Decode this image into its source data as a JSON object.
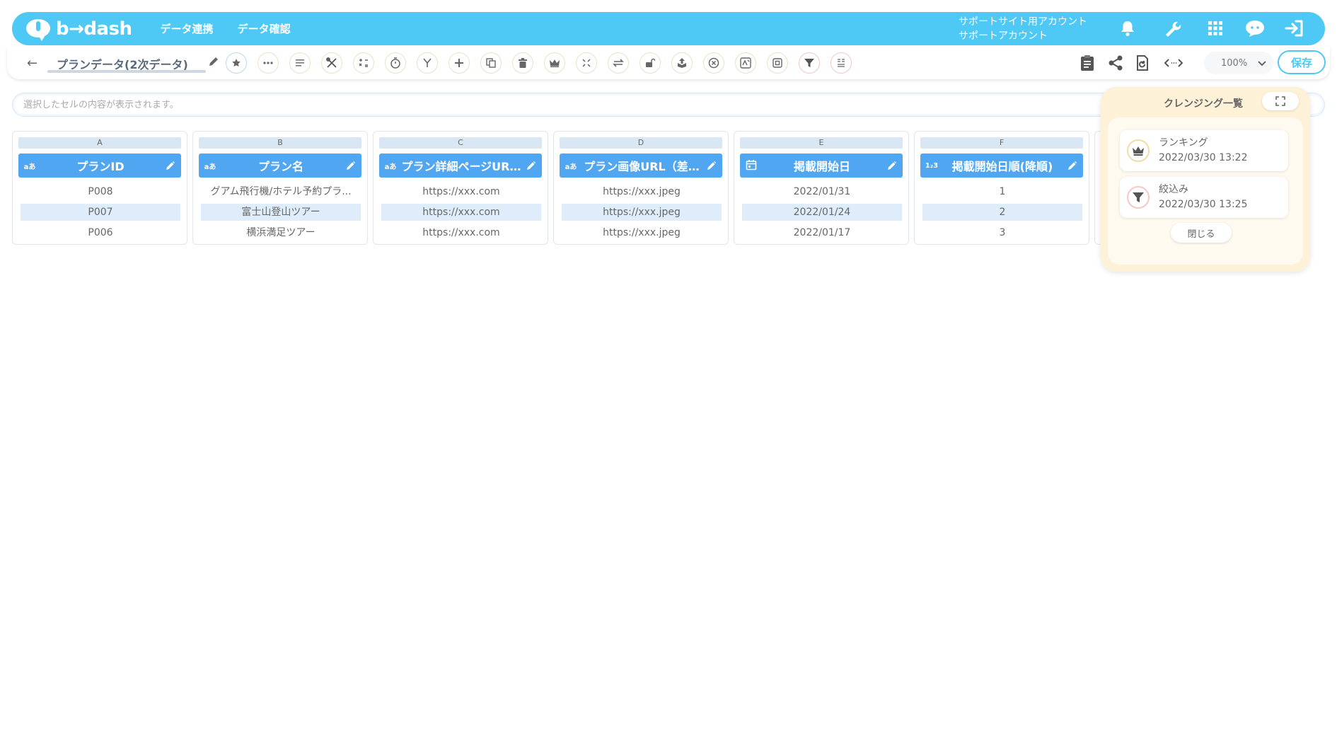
{
  "app": {
    "logo_text": "b→dash",
    "nav": [
      "データ連携",
      "データ確認"
    ],
    "account_line1": "サポートサイト用アカウント",
    "account_line2": "サポートアカウント"
  },
  "header_icons": [
    "bell-icon",
    "wrench-icon",
    "grid-icon",
    "chat-icon",
    "logout-icon"
  ],
  "toolbar": {
    "back_icon": "←",
    "dataset_title": "プランデータ(2次データ)",
    "tools": [
      "star-icon",
      "dots-icon",
      "list-icon",
      "tools-icon",
      "calculator-icon",
      "timer-icon",
      "merge-icon",
      "plus-icon",
      "copy-icon",
      "trash-icon",
      "crown-icon",
      "collapse-icon",
      "swap-icon",
      "lock-icon",
      "upload-icon",
      "cancel-icon",
      "transform-icon",
      "square-icon",
      "filter-icon",
      "sort-icon"
    ],
    "right_icons": [
      "clipboard-icon",
      "share-icon",
      "refresh-icon",
      "code-icon"
    ],
    "zoom": "100%",
    "save_label": "保存"
  },
  "cellbar": {
    "placeholder": "選択したセルの内容が表示されます。"
  },
  "columns": [
    {
      "letter": "A",
      "type": "aあ",
      "name": "プランID",
      "cells": [
        "P008",
        "P007",
        "P006"
      ]
    },
    {
      "letter": "B",
      "type": "aあ",
      "name": "プラン名",
      "cells": [
        "グアム飛行機/ホテル予約プラ...",
        "富士山登山ツアー",
        "横浜満足ツアー"
      ]
    },
    {
      "letter": "C",
      "type": "aあ",
      "name": "プラン詳細ページUR…",
      "cells": [
        "https://xxx.com",
        "https://xxx.com",
        "https://xxx.com"
      ]
    },
    {
      "letter": "D",
      "type": "aあ",
      "name": "プラン画像URL（差…",
      "cells": [
        "https://xxx.jpeg",
        "https://xxx.jpeg",
        "https://xxx.jpeg"
      ]
    },
    {
      "letter": "E",
      "type": "date",
      "name": "掲載開始日",
      "cells": [
        "2022/01/31",
        "2022/01/24",
        "2022/01/17"
      ]
    },
    {
      "letter": "F",
      "type": "1₂3",
      "name": "掲載開始日順(降順)",
      "cells": [
        "1",
        "2",
        "3"
      ]
    }
  ],
  "panel": {
    "title": "クレンジング一覧",
    "steps": [
      {
        "name": "ランキング",
        "time": "2022/03/30 13:22",
        "icon": "crown-icon"
      },
      {
        "name": "絞込み",
        "time": "2022/03/30 13:25",
        "icon": "filter-icon"
      }
    ],
    "close_label": "閉じる"
  },
  "colors": {
    "accent": "#4ec9f5",
    "header_blue": "#50a6f0",
    "panel_bg": "#fdf2d8"
  }
}
